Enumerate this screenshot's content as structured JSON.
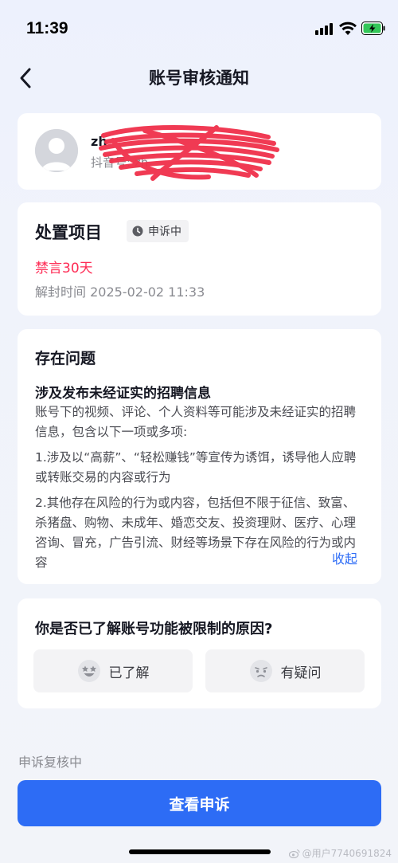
{
  "status_bar": {
    "time": "11:39"
  },
  "nav": {
    "title": "账号审核通知",
    "back_icon": "chevron-left-icon"
  },
  "user": {
    "name": "zh",
    "id_label": "抖音号: zh",
    "avatar_icon": "default-avatar-icon",
    "redacted": true
  },
  "action": {
    "title": "处置项目",
    "badge_label": "申诉中",
    "penalty": "禁言30天",
    "unban_time": "解封时间 2025-02-02 11:33"
  },
  "issue": {
    "title": "存在问题",
    "subtitle": "涉及发布未经证实的招聘信息",
    "description": "账号下的视频、评论、个人资料等可能涉及未经证实的招聘信息，包含以下一项或多项:",
    "item1": "1.涉及以“高薪”、“轻松赚钱”等宣传为诱饵，诱导他人应聘或转账交易的内容或行为",
    "item2": "2.其他存在风险的行为或内容，包括但不限于征信、致富、杀猪盘、购物、未成年、婚恋交友、投资理财、医疗、心理咨询、冒充，广告引流、财经等场景下存在风险的行为或内容",
    "collapse_label": "收起"
  },
  "feedback": {
    "question": "你是否已了解账号功能被限制的原因?",
    "understood_label": "已了解",
    "question_label": "有疑问"
  },
  "footer": {
    "review_status": "申诉复核中",
    "view_appeal_label": "查看申诉"
  },
  "watermark": {
    "text": "@用户7740691824"
  },
  "colors": {
    "accent": "#2d6cf5",
    "penalty": "#fe2c55",
    "link": "#2f6df6"
  }
}
